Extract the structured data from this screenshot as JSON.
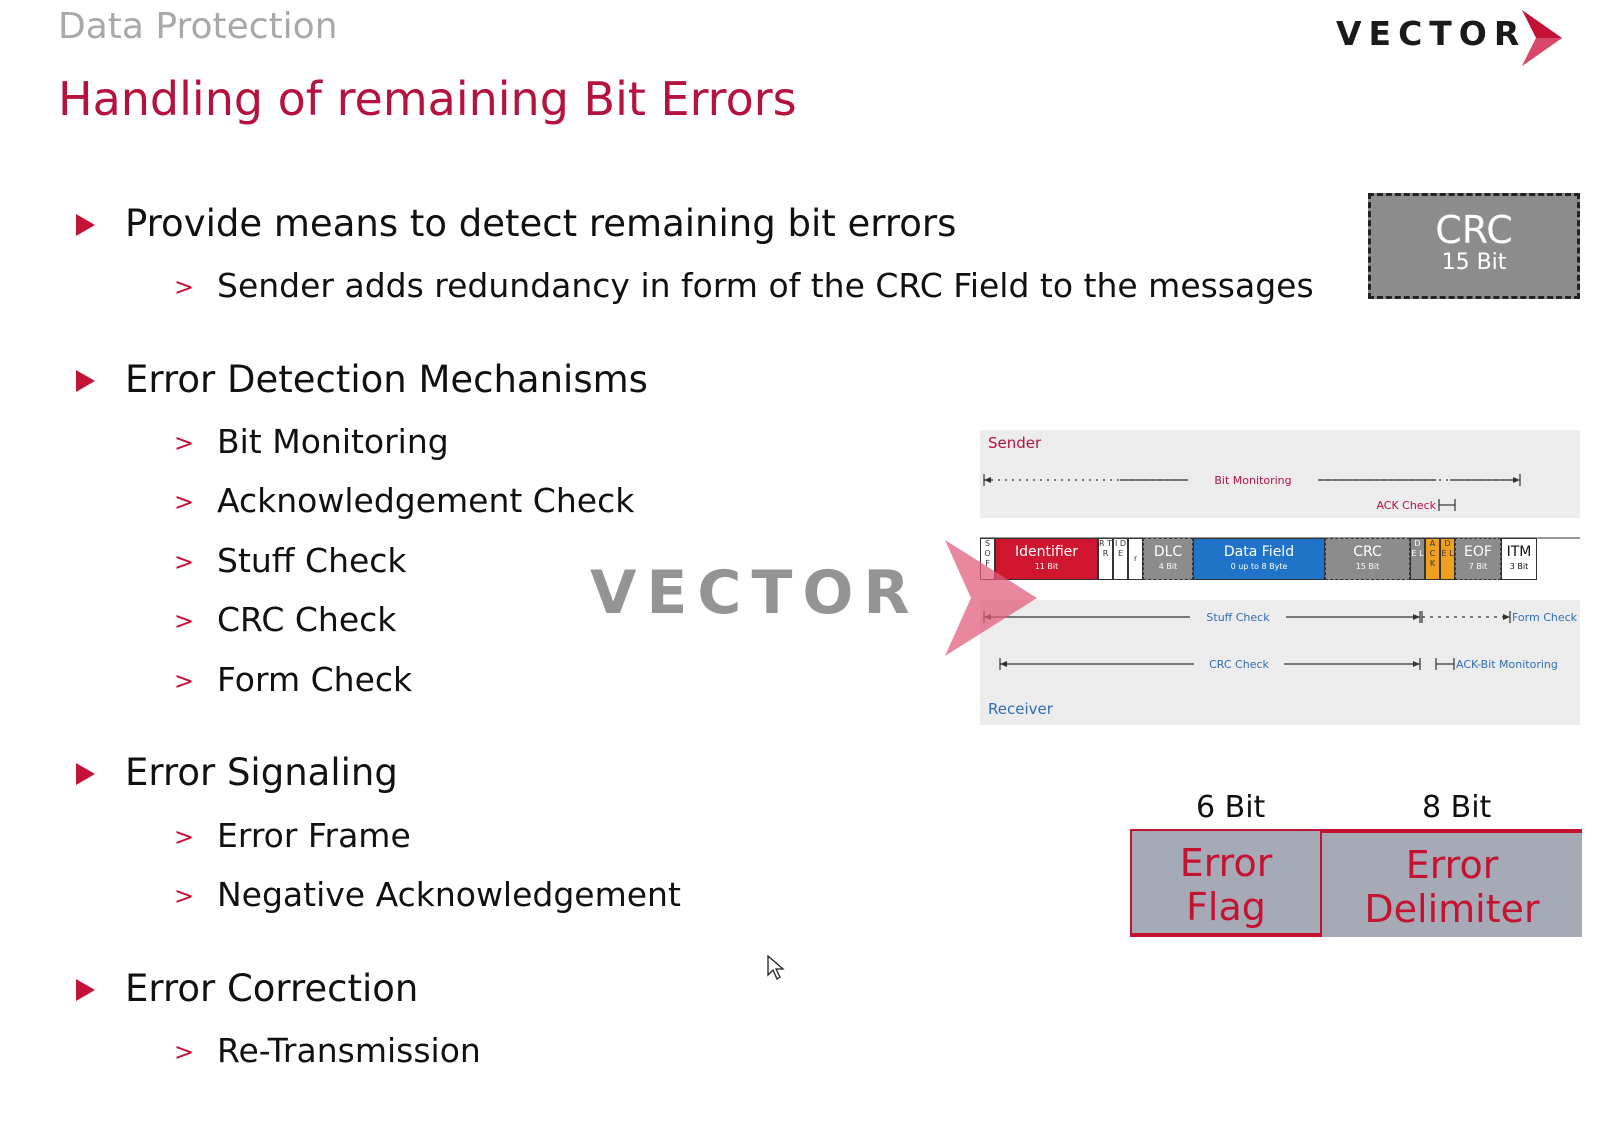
{
  "header": {
    "section_label": "Data Protection",
    "title": "Handling of remaining Bit Errors",
    "logo_text": "VECTOR"
  },
  "bullets": [
    {
      "label": "Provide means to detect remaining bit errors",
      "subs": [
        "Sender adds redundancy in form of the CRC Field to the messages"
      ]
    },
    {
      "label": "Error Detection Mechanisms",
      "subs": [
        "Bit Monitoring",
        "Acknowledgement Check",
        "Stuff Check",
        "CRC Check",
        "Form Check"
      ]
    },
    {
      "label": "Error Signaling",
      "subs": [
        "Error Frame",
        "Negative Acknowledgement"
      ]
    },
    {
      "label": "Error Correction",
      "subs": [
        "Re-Transmission"
      ]
    }
  ],
  "crc_box": {
    "title": "CRC",
    "subtitle": "15 Bit"
  },
  "diagram": {
    "sender_label": "Sender",
    "receiver_label": "Receiver",
    "bit_monitoring": "Bit Monitoring",
    "ack_check": "ACK Check",
    "stuff_check": "Stuff Check",
    "form_check": "Form Check",
    "crc_check": "CRC Check",
    "ack_bit_monitoring": "ACK-Bit Monitoring",
    "fields": {
      "sof": "S O F",
      "identifier": {
        "name": "Identifier",
        "bits": "11 Bit"
      },
      "rtr": "R T R",
      "ide": "I D E",
      "r": "r",
      "dlc": {
        "name": "DLC",
        "bits": "4 Bit"
      },
      "data": {
        "name": "Data Field",
        "bits": "0 up to 8 Byte"
      },
      "crc": {
        "name": "CRC",
        "bits": "15 Bit"
      },
      "del1": "D E L",
      "ack": "A C K",
      "del2": "D E L",
      "eof": {
        "name": "EOF",
        "bits": "7 Bit"
      },
      "itm": {
        "name": "ITM",
        "bits": "3 Bit"
      }
    }
  },
  "watermark": {
    "text": "VECTOR"
  },
  "error_frame": {
    "flag_bits": "6 Bit",
    "delim_bits": "8 Bit",
    "flag_label_1": "Error",
    "flag_label_2": "Flag",
    "delim_label_1": "Error",
    "delim_label_2": "Delimiter"
  },
  "colors": {
    "accent": "#c41237",
    "title": "#b5123e",
    "identifier": "#d0162f",
    "data_field": "#1f74c9",
    "crc": "#8c8c8c",
    "ack": "#f0a020",
    "error_box": "#a6aab6"
  },
  "icons": [
    "triangle-bullet-icon",
    "chevron-bullet-icon",
    "vector-logo",
    "mouse-cursor-icon"
  ]
}
